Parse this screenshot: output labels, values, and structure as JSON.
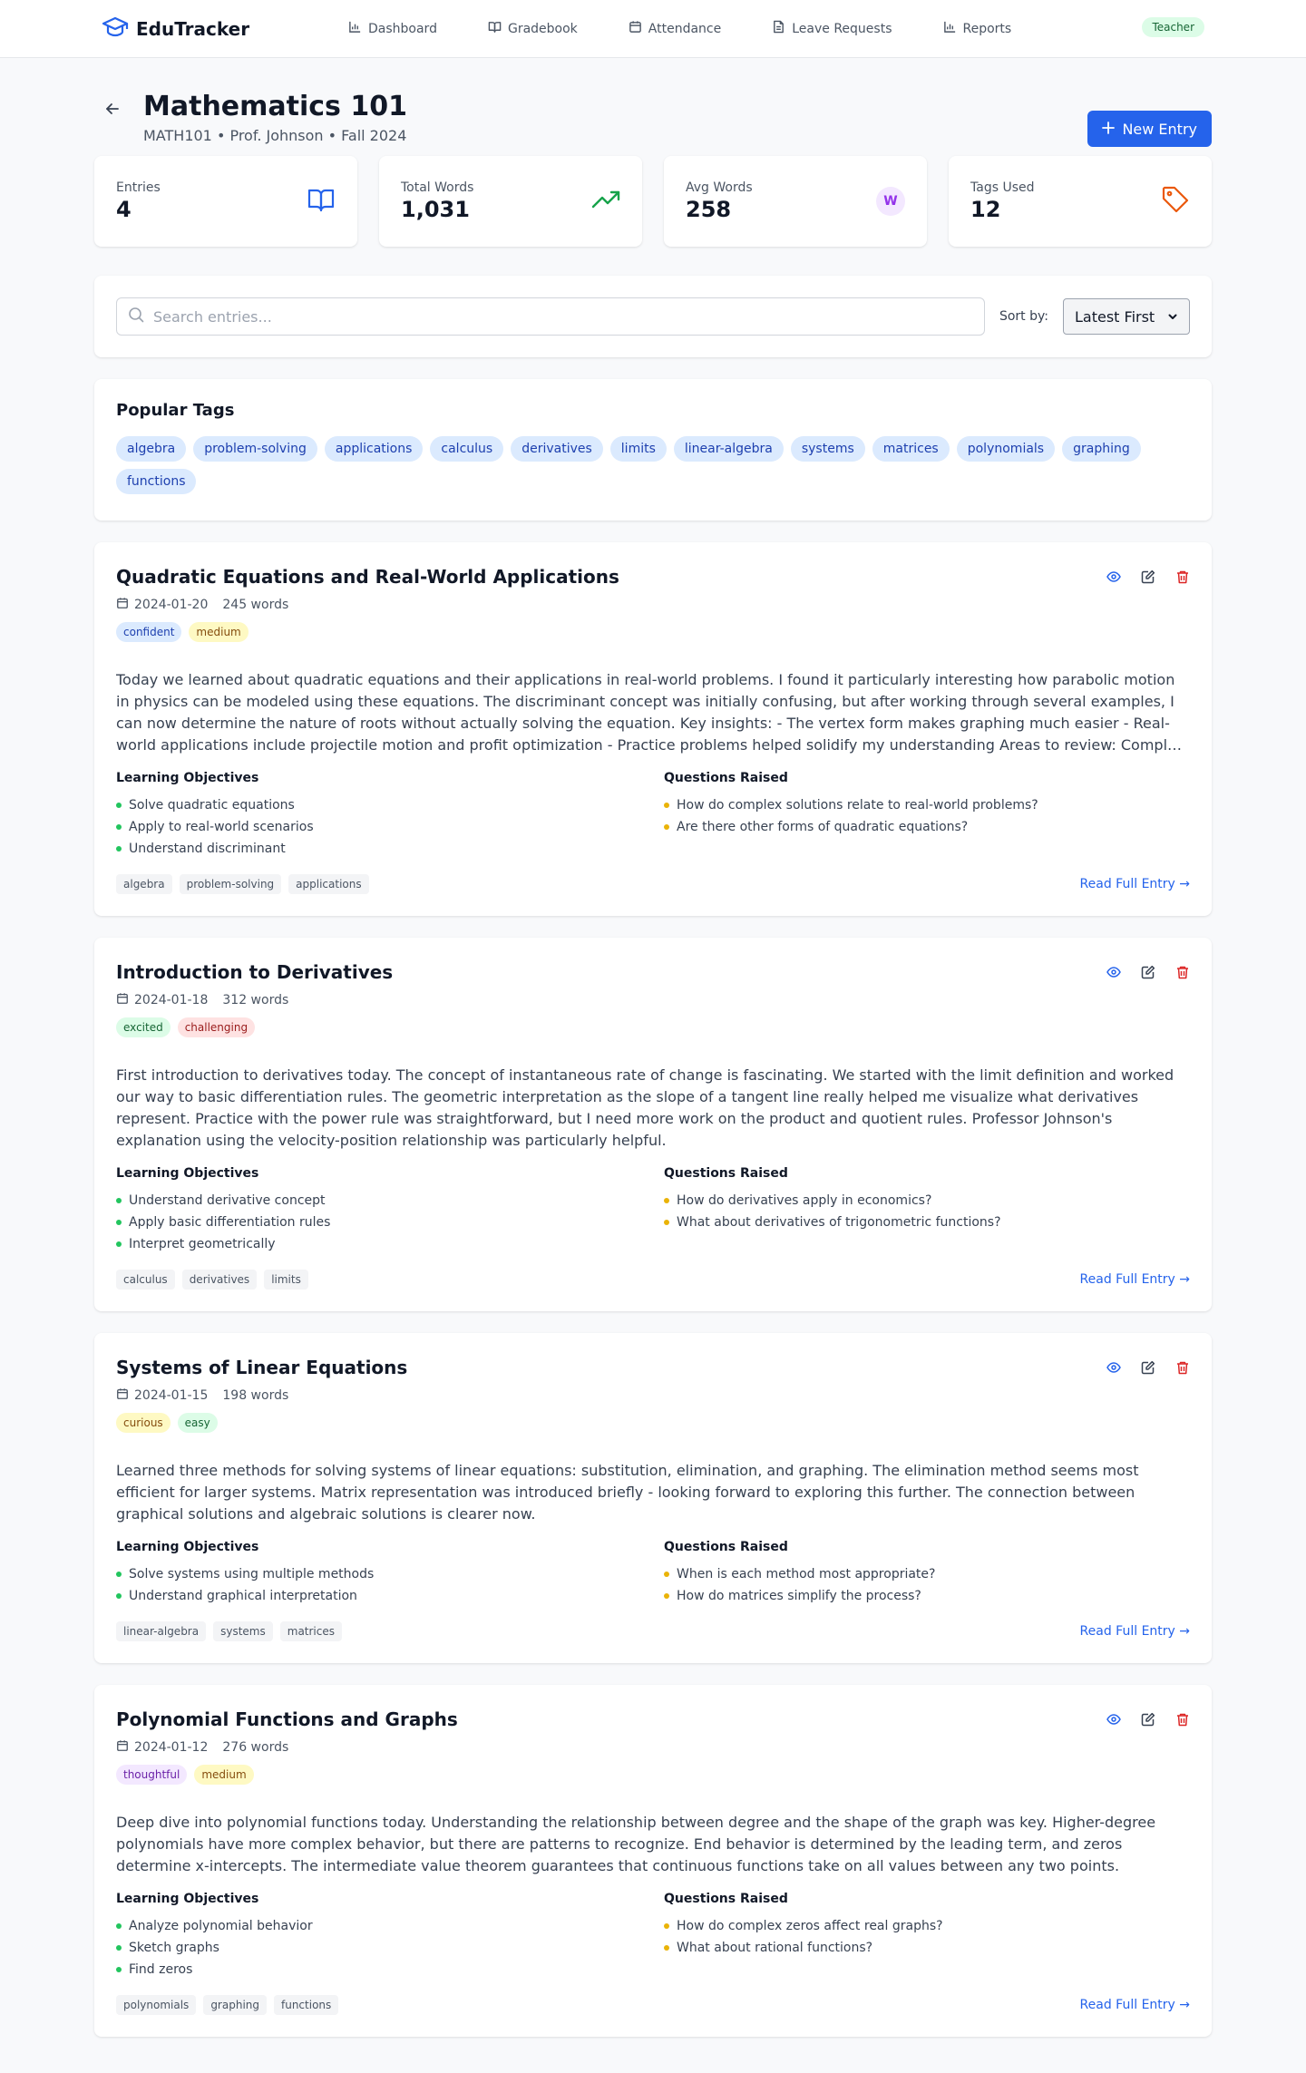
{
  "nav": {
    "brand": "EduTracker",
    "items": [
      {
        "label": "Dashboard",
        "icon": "bar-chart-icon"
      },
      {
        "label": "Gradebook",
        "icon": "book-open-icon"
      },
      {
        "label": "Attendance",
        "icon": "calendar-icon"
      },
      {
        "label": "Leave Requests",
        "icon": "file-text-icon"
      },
      {
        "label": "Reports",
        "icon": "bar-chart-icon"
      }
    ],
    "role": "Teacher"
  },
  "header": {
    "title": "Mathematics 101",
    "subtitle": "MATH101 • Prof. Johnson • Fall 2024",
    "new_entry_label": "New Entry"
  },
  "stats": [
    {
      "label": "Entries",
      "value": "4",
      "icon": "book-open-icon",
      "color": "#2563eb"
    },
    {
      "label": "Total Words",
      "value": "1,031",
      "icon": "trending-up-icon",
      "color": "#16a34a"
    },
    {
      "label": "Avg Words",
      "value": "258",
      "icon": "w-letter-icon",
      "icon_text": "W",
      "color": "#9333ea"
    },
    {
      "label": "Tags Used",
      "value": "12",
      "icon": "tag-icon",
      "color": "#ea580c"
    }
  ],
  "search": {
    "placeholder": "Search entries...",
    "sort_label": "Sort by:",
    "sort_value": "Latest First"
  },
  "popular_tags": {
    "title": "Popular Tags",
    "tags": [
      "algebra",
      "problem-solving",
      "applications",
      "calculus",
      "derivatives",
      "limits",
      "linear-algebra",
      "systems",
      "matrices",
      "polynomials",
      "graphing",
      "functions"
    ]
  },
  "labels": {
    "objectives": "Learning Objectives",
    "questions": "Questions Raised",
    "read_full": "Read Full Entry →"
  },
  "entries": [
    {
      "title": "Quadratic Equations and Real-World Applications",
      "date": "2024-01-20",
      "words": "245 words",
      "badges": [
        {
          "text": "confident",
          "bg": "#dbeafe",
          "fg": "#1e40af"
        },
        {
          "text": "medium",
          "bg": "#fef9c3",
          "fg": "#854d0e"
        }
      ],
      "body": "Today we learned about quadratic equations and their applications in real-world problems. I found it particularly interesting how parabolic motion in physics can be modeled using these equations. The discriminant concept was initially confusing, but after working through several examples, I can now determine the nature of roots without actually solving the equation. Key insights: - The vertex form makes graphing much easier - Real-world applications include projectile motion and profit optimization - Practice problems helped solidify my understanding Areas to review: Complex solutions and their interpretation.",
      "clamp": true,
      "objectives": [
        "Solve quadratic equations",
        "Apply to real-world scenarios",
        "Understand discriminant"
      ],
      "questions": [
        "How do complex solutions relate to real-world problems?",
        "Are there other forms of quadratic equations?"
      ],
      "tags": [
        "algebra",
        "problem-solving",
        "applications"
      ]
    },
    {
      "title": "Introduction to Derivatives",
      "date": "2024-01-18",
      "words": "312 words",
      "badges": [
        {
          "text": "excited",
          "bg": "#dcfce7",
          "fg": "#166534"
        },
        {
          "text": "challenging",
          "bg": "#fee2e2",
          "fg": "#991b1b"
        }
      ],
      "body": "First introduction to derivatives today. The concept of instantaneous rate of change is fascinating. We started with the limit definition and worked our way to basic differentiation rules. The geometric interpretation as the slope of a tangent line really helped me visualize what derivatives represent. Practice with the power rule was straightforward, but I need more work on the product and quotient rules. Professor Johnson's explanation using the velocity-position relationship was particularly helpful.",
      "clamp": false,
      "objectives": [
        "Understand derivative concept",
        "Apply basic differentiation rules",
        "Interpret geometrically"
      ],
      "questions": [
        "How do derivatives apply in economics?",
        "What about derivatives of trigonometric functions?"
      ],
      "tags": [
        "calculus",
        "derivatives",
        "limits"
      ]
    },
    {
      "title": "Systems of Linear Equations",
      "date": "2024-01-15",
      "words": "198 words",
      "badges": [
        {
          "text": "curious",
          "bg": "#fef9c3",
          "fg": "#854d0e"
        },
        {
          "text": "easy",
          "bg": "#dcfce7",
          "fg": "#166534"
        }
      ],
      "body": "Learned three methods for solving systems of linear equations: substitution, elimination, and graphing. The elimination method seems most efficient for larger systems. Matrix representation was introduced briefly - looking forward to exploring this further. The connection between graphical solutions and algebraic solutions is clearer now.",
      "clamp": false,
      "objectives": [
        "Solve systems using multiple methods",
        "Understand graphical interpretation"
      ],
      "questions": [
        "When is each method most appropriate?",
        "How do matrices simplify the process?"
      ],
      "tags": [
        "linear-algebra",
        "systems",
        "matrices"
      ]
    },
    {
      "title": "Polynomial Functions and Graphs",
      "date": "2024-01-12",
      "words": "276 words",
      "badges": [
        {
          "text": "thoughtful",
          "bg": "#f3e8ff",
          "fg": "#6b21a8"
        },
        {
          "text": "medium",
          "bg": "#fef9c3",
          "fg": "#854d0e"
        }
      ],
      "body": "Deep dive into polynomial functions today. Understanding the relationship between degree and the shape of the graph was key. Higher-degree polynomials have more complex behavior, but there are patterns to recognize. End behavior is determined by the leading term, and zeros determine x-intercepts. The intermediate value theorem guarantees that continuous functions take on all values between any two points.",
      "clamp": false,
      "objectives": [
        "Analyze polynomial behavior",
        "Sketch graphs",
        "Find zeros"
      ],
      "questions": [
        "How do complex zeros affect real graphs?",
        "What about rational functions?"
      ],
      "tags": [
        "polynomials",
        "graphing",
        "functions"
      ]
    }
  ]
}
